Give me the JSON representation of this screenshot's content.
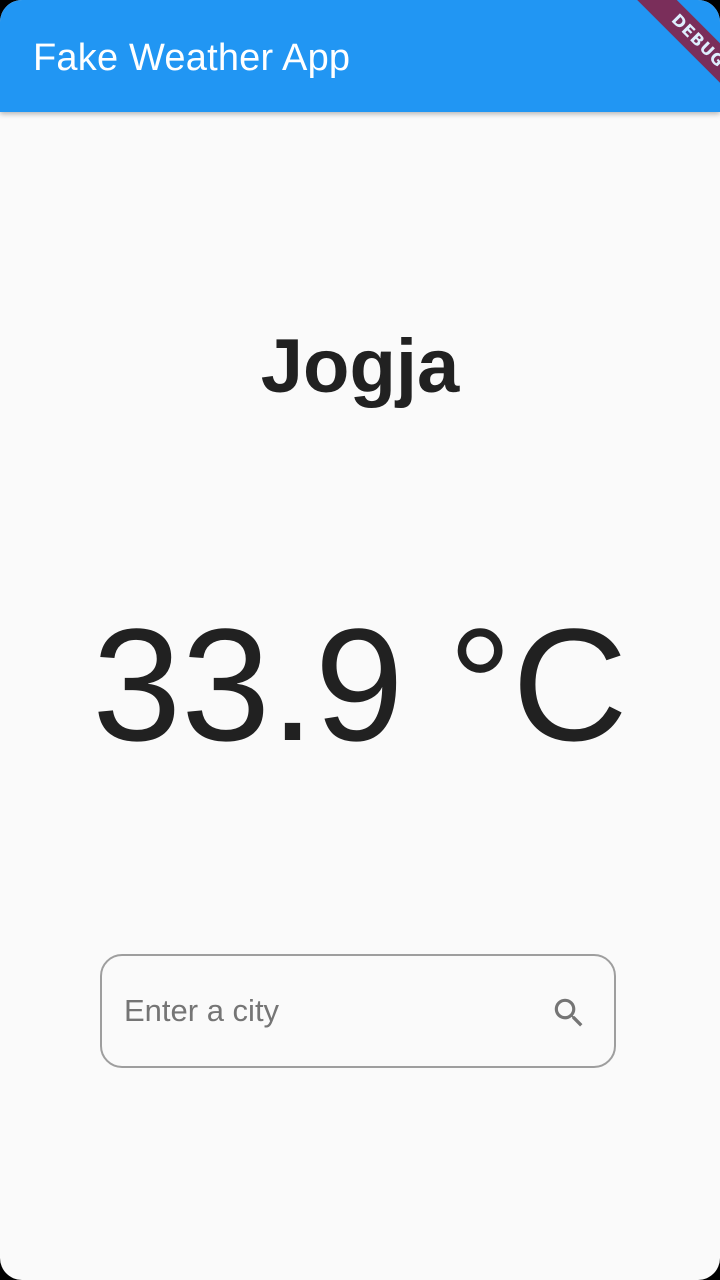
{
  "app_bar": {
    "title": "Fake Weather App",
    "debug_label": "DEBUG",
    "color": "#2196f3"
  },
  "weather": {
    "city": "Jogja",
    "temperature": "33.9 °C"
  },
  "search": {
    "placeholder": "Enter a city",
    "value": "",
    "icon": "search-icon"
  }
}
